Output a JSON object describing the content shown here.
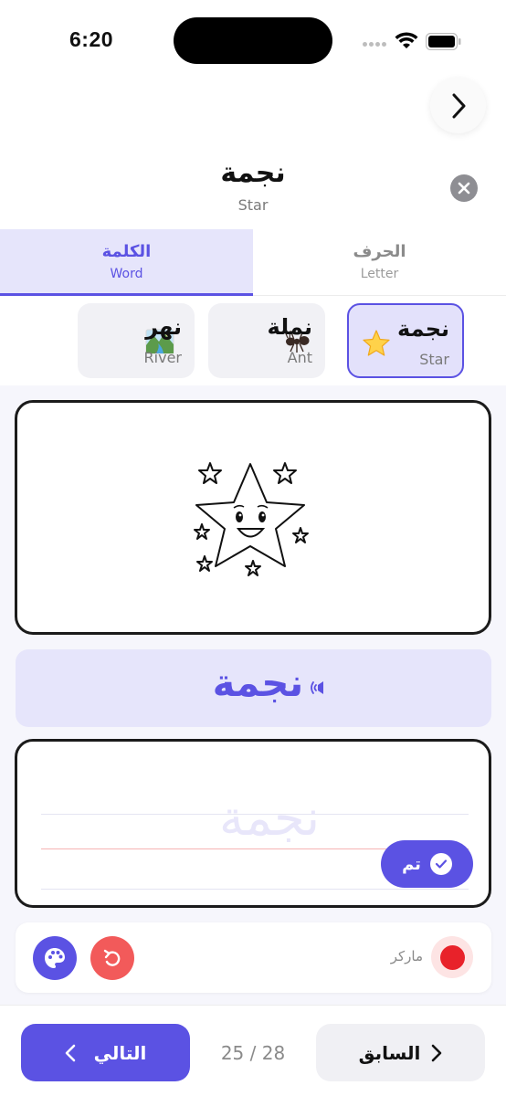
{
  "status_bar": {
    "time": "6:20"
  },
  "header": {
    "title": "نجمة",
    "subtitle": "Star"
  },
  "tabs": [
    {
      "label_ar": "الكلمة",
      "label_en": "Word",
      "selected": true
    },
    {
      "label_ar": "الحرف",
      "label_en": "Letter",
      "selected": false
    }
  ],
  "words": [
    {
      "ar": "نجمة",
      "en": "Star",
      "icon": "star-emoji",
      "selected": true
    },
    {
      "ar": "نملة",
      "en": "Ant",
      "icon": "ant-emoji",
      "selected": false
    },
    {
      "ar": "نهر",
      "en": "River",
      "icon": "river-landscape-emoji",
      "selected": false
    }
  ],
  "main": {
    "illustration": "smiling-star-coloring-page",
    "word_display": "نجمة",
    "trace_word": "نجمة",
    "done_label": "تم"
  },
  "tools": {
    "marker_label": "ماركر",
    "marker_color": "#e8222a",
    "undo_color": "#f25a5a",
    "accent": "#5b52e3"
  },
  "footer": {
    "next_label": "التالي",
    "prev_label": "السابق",
    "page_counter": "25 / 28"
  }
}
